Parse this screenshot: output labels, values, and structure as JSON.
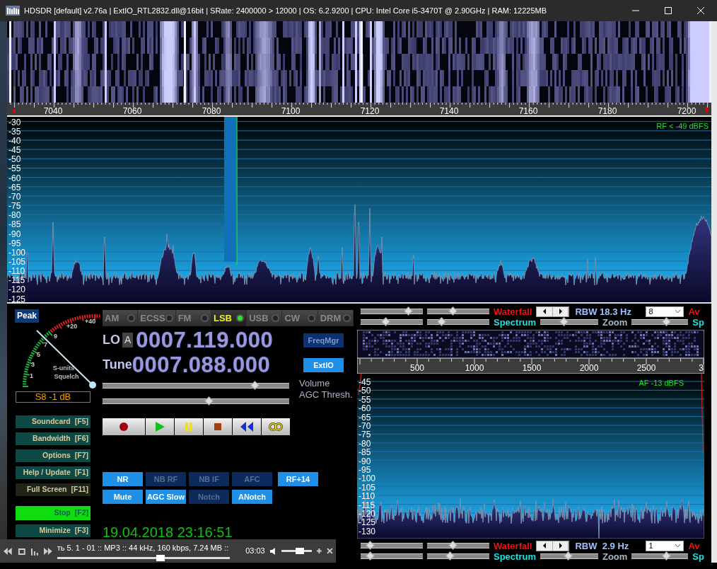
{
  "window": {
    "title": "HDSDR  [default]  v2.76a  |  ExtIO_RTL2832.dll@16bit  |  SRate: 2400000 > 12000  |  OS: 6.2.9200   |  CPU: Intel Core i5-3470T @ 2.90GHz  |  RAM: 12225MB"
  },
  "rf_display": {
    "freq_labels": [
      "7040",
      "7060",
      "7080",
      "7100",
      "7120",
      "7140",
      "7160",
      "7180",
      "7200"
    ],
    "db_labels": [
      "-30",
      "-35",
      "-40",
      "-45",
      "-50",
      "-55",
      "-60",
      "-65",
      "-70",
      "-75",
      "-80",
      "-85",
      "-90",
      "-95",
      "-100",
      "-105",
      "-110",
      "-115",
      "-120",
      "-125"
    ],
    "level_note": "RF < -49 dBFS"
  },
  "meter": {
    "peak_button": "Peak",
    "scale_labels": [
      "1",
      "3",
      "5",
      "7",
      "9",
      "+20",
      "+40"
    ],
    "caption_1": "S-units",
    "caption_2": "Squelch",
    "reading": "S8 -1 dB"
  },
  "side_buttons": [
    {
      "label": "Soundcard",
      "key": "[F5]",
      "kind": "normal"
    },
    {
      "label": "Bandwidth",
      "key": "[F6]",
      "kind": "normal"
    },
    {
      "label": "Options",
      "key": "[F7]",
      "kind": "normal"
    },
    {
      "label": "Help / Update",
      "key": "[F1]",
      "kind": "normal"
    },
    {
      "label": "Full Screen",
      "key": "[F11]",
      "kind": "dim"
    },
    {
      "label": "Stop",
      "key": "[F2]",
      "kind": "running"
    },
    {
      "label": "Minimize",
      "key": "[F3]",
      "kind": "normal"
    }
  ],
  "modes": [
    {
      "label": "AM",
      "selected": false
    },
    {
      "label": "ECSS",
      "selected": false
    },
    {
      "label": "FM",
      "selected": false
    },
    {
      "label": "LSB",
      "selected": true
    },
    {
      "label": "USB",
      "selected": false
    },
    {
      "label": "CW",
      "selected": false
    },
    {
      "label": "DRM",
      "selected": false
    }
  ],
  "lo": {
    "label": "LO",
    "bank": "A",
    "value": "0007.119.000"
  },
  "tune": {
    "label": "Tune",
    "value": "0007.088.000"
  },
  "side_toggles": [
    {
      "label": "FreqMgr",
      "on": false
    },
    {
      "label": "ExtIO",
      "on": true
    }
  ],
  "sliders": [
    {
      "label": "Volume",
      "level": 0.84
    },
    {
      "label": "AGC Thresh.",
      "level": 0.58
    }
  ],
  "transport": [
    {
      "kind": "record"
    },
    {
      "kind": "play"
    },
    {
      "kind": "pause"
    },
    {
      "kind": "stop"
    },
    {
      "kind": "rewind"
    },
    {
      "kind": "loop"
    }
  ],
  "dsp_rows": [
    [
      {
        "label": "NR",
        "on": true
      },
      {
        "label": "NB RF",
        "on": false
      },
      {
        "label": "NB IF",
        "on": false
      },
      {
        "label": "AFC",
        "on": false
      },
      {
        "label": "RF+14",
        "on": true
      }
    ],
    [
      {
        "label": "Mute",
        "on": true
      },
      {
        "label": "AGC Slow",
        "on": true
      },
      {
        "label": "Notch",
        "on": false
      },
      {
        "label": "ANotch",
        "on": true
      }
    ]
  ],
  "clock": "19.04.2018 23:16:51",
  "rf_controls": {
    "row_1_sliders": [
      {
        "level": 0.83
      },
      {
        "level": 0.41
      }
    ],
    "waterfall_label": "Waterfall",
    "rbw": "RBW 18.3 Hz",
    "select_value": "8",
    "cut_label_1": "Av",
    "row_2_sliders": [
      {
        "level": 0.4
      },
      {
        "level": 0.19
      }
    ],
    "spectrum_label": "Spectrum",
    "zoom_slider": {
      "level": 0.4
    },
    "zoom_label": "Zoom",
    "right_slider": {
      "level": 0.65
    },
    "cut_label_2": "Sp"
  },
  "af_display": {
    "freq_labels": [
      "500",
      "1000",
      "1500",
      "2000",
      "2500",
      "3"
    ],
    "db_labels": [
      "-45",
      "-50",
      "-55",
      "-60",
      "-65",
      "-70",
      "-75",
      "-80",
      "-85",
      "-90",
      "-95",
      "-100",
      "-105",
      "-110",
      "-115",
      "-120",
      "-125",
      "-130"
    ],
    "level_note": "AF -13 dBFS"
  },
  "af_controls": {
    "row_1_sliders": [
      {
        "level": 0.1
      },
      {
        "level": 0.41
      }
    ],
    "waterfall_label": "Waterfall",
    "rbw": "RBW  2.9 Hz",
    "select_value": "1",
    "cut_label_1": "Av",
    "row_2_sliders": [
      {
        "level": 0.1
      },
      {
        "level": 0.35
      }
    ],
    "spectrum_label": "Spectrum",
    "zoom_slider": {
      "level": 0.5
    },
    "zoom_label": "Zoom",
    "right_slider": {
      "level": 0.65
    },
    "cut_label_2": "Sp"
  },
  "media_player": {
    "track": "ть 5. 1  -  01 :: MP3 :: 44 kHz, 160 kbps, 7.24 MB ::",
    "time": "03:03",
    "level": 0.6,
    "volume": {
      "level": 0.6
    }
  }
}
